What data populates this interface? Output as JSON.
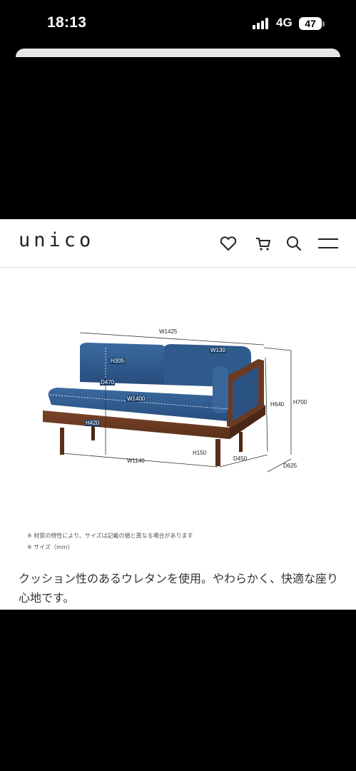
{
  "status_bar": {
    "time": "18:13",
    "network": "4G",
    "battery": "47"
  },
  "header": {
    "logo": "unico",
    "icons": [
      "heart-icon",
      "cart-icon",
      "search-icon",
      "menu-icon"
    ]
  },
  "diagram": {
    "w1425": "W1425",
    "h305": "H305",
    "w130": "W130",
    "d470": "D470",
    "w1400": "W1400",
    "h420": "H420",
    "h640": "H640",
    "h700": "H700",
    "h150": "H150",
    "w1140": "W1140",
    "d450": "D450",
    "d625": "D625",
    "denim_color": "#2f5a8c",
    "wood_color": "#6b3a22"
  },
  "notes": [
    "※ 材質の特性により、サイズは記載の値と異なる場合があります",
    "※ サイズ（mm）"
  ],
  "description": "クッション性のあるウレタンを使用。やわらかく、快適な座り心地です。"
}
